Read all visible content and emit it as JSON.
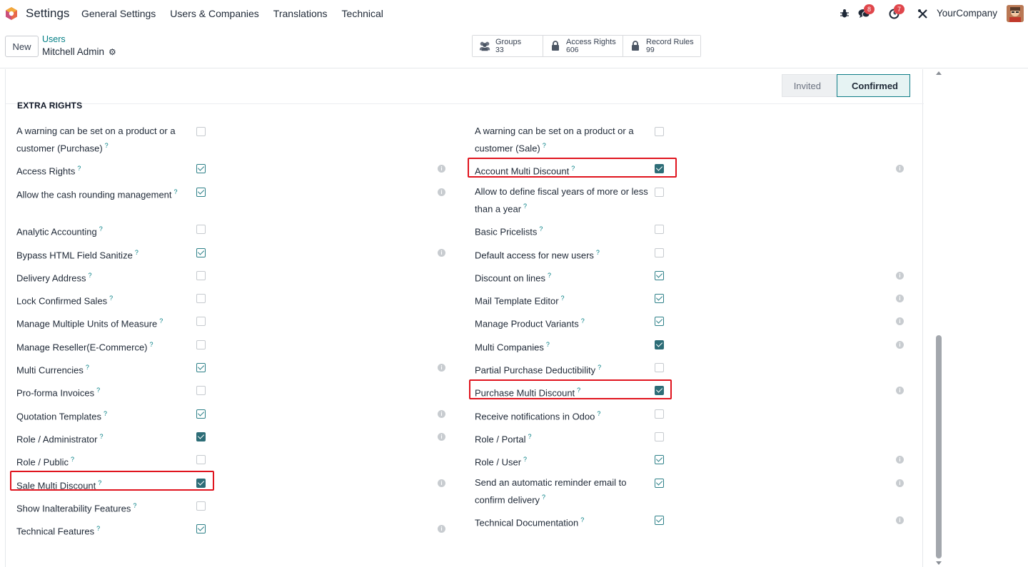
{
  "navbar": {
    "app_title": "Settings",
    "menu": [
      "General Settings",
      "Users & Companies",
      "Translations",
      "Technical"
    ],
    "messages_count": "8",
    "activities_count": "7",
    "company": "YourCompany"
  },
  "control": {
    "new_label": "New",
    "breadcrumb": "Users",
    "record_name": "Mitchell Admin",
    "smart_buttons": [
      {
        "label": "Groups",
        "value": "33",
        "icon": "users-icon"
      },
      {
        "label": "Access Rights",
        "value": "606",
        "icon": "lock-icon"
      },
      {
        "label": "Record Rules",
        "value": "99",
        "icon": "lock-icon"
      }
    ]
  },
  "status": {
    "invited": "Invited",
    "confirmed": "Confirmed"
  },
  "section": {
    "title": "EXTRA RIGHTS"
  },
  "colors": {
    "accent": "#017e84",
    "highlight": "#e0141e"
  },
  "left_fields": [
    {
      "label": "A warning can be set on a product or a customer (Purchase)",
      "checked": false,
      "info": false
    },
    {
      "label": "Access Rights",
      "checked": true,
      "info": true
    },
    {
      "label": "Allow the cash rounding management",
      "checked": true,
      "info": true
    },
    {
      "label": "Analytic Accounting",
      "checked": false,
      "info": false
    },
    {
      "label": "Bypass HTML Field Sanitize",
      "checked": true,
      "info": true
    },
    {
      "label": "Delivery Address",
      "checked": false,
      "info": false
    },
    {
      "label": "Lock Confirmed Sales",
      "checked": false,
      "info": false
    },
    {
      "label": "Manage Multiple Units of Measure",
      "checked": false,
      "info": false
    },
    {
      "label": "Manage Reseller(E-Commerce)",
      "checked": false,
      "info": false
    },
    {
      "label": "Multi Currencies",
      "checked": true,
      "info": true
    },
    {
      "label": "Pro-forma Invoices",
      "checked": false,
      "info": false
    },
    {
      "label": "Quotation Templates",
      "checked": true,
      "info": true
    },
    {
      "label": "Role / Administrator",
      "checked": true,
      "info": true
    },
    {
      "label": "Role / Public",
      "checked": false,
      "info": false
    },
    {
      "label": "Sale Multi Discount",
      "checked": true,
      "info": true
    },
    {
      "label": "Show Inalterability Features",
      "checked": false,
      "info": false
    },
    {
      "label": "Technical Features",
      "checked": true,
      "info": true
    }
  ],
  "right_fields": [
    {
      "label": "A warning can be set on a product or a customer (Sale)",
      "checked": false,
      "info": false
    },
    {
      "label": "Account Multi Discount",
      "checked": true,
      "info": true
    },
    {
      "label": "Allow to define fiscal years of more or less than a year",
      "checked": false,
      "info": false
    },
    {
      "label": "Basic Pricelists",
      "checked": false,
      "info": false
    },
    {
      "label": "Default access for new users",
      "checked": false,
      "info": false
    },
    {
      "label": "Discount on lines",
      "checked": true,
      "info": true
    },
    {
      "label": "Mail Template Editor",
      "checked": true,
      "info": true
    },
    {
      "label": "Manage Product Variants",
      "checked": true,
      "info": true
    },
    {
      "label": "Multi Companies",
      "checked": true,
      "info": true
    },
    {
      "label": "Partial Purchase Deductibility",
      "checked": false,
      "info": false
    },
    {
      "label": "Purchase Multi Discount",
      "checked": true,
      "info": true
    },
    {
      "label": "Receive notifications in Odoo",
      "checked": false,
      "info": false
    },
    {
      "label": "Role / Portal",
      "checked": false,
      "info": false
    },
    {
      "label": "Role / User",
      "checked": true,
      "info": true
    },
    {
      "label": "Send an automatic reminder email to confirm delivery",
      "checked": true,
      "info": true
    },
    {
      "label": "Technical Documentation",
      "checked": true,
      "info": true
    }
  ]
}
